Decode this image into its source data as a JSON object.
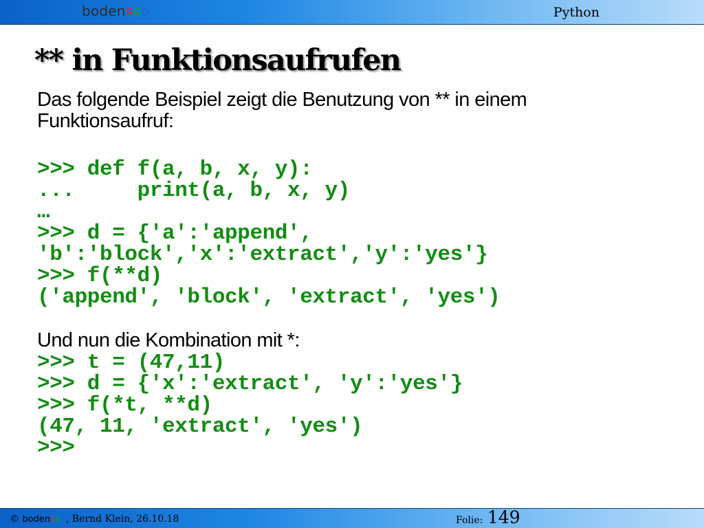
{
  "header": {
    "logo": {
      "part1": "boden",
      "part_s": "s",
      "part_e": "e",
      "part_o": "o"
    },
    "title": "Python"
  },
  "slide": {
    "title": "** in Funktionsaufrufen",
    "intro": "Das folgende Beispiel zeigt die Benutzung von ** in einem Funktionsaufruf:",
    "code_block_1": [
      ">>> def f(a, b, x, y):",
      "...     print(a, b, x, y)",
      "…",
      ">>> d = {'a':'append',",
      "'b':'block','x':'extract','y':'yes'}",
      ">>> f(**d)",
      "('append', 'block', 'extract', 'yes')"
    ],
    "combo_intro": "Und nun die Kombination mit *:",
    "code_block_2": [
      ">>> t = (47,11)",
      ">>> d = {'x':'extract', 'y':'yes'}",
      ">>> f(*t, **d)",
      "(47, 11, 'extract', 'yes')",
      ">>>"
    ]
  },
  "footer": {
    "copyright_symbol": "©",
    "brand_part1": "boden",
    "brand_s": "s",
    "brand_e": "e",
    "brand_o": "o",
    "author_date": ", Bernd Klein, 26.10.18",
    "folie_label": "Folie:",
    "folie_number": "149"
  },
  "colors": {
    "code_green": "#138c13",
    "bar_blue": "#1d86e3",
    "logo_red": "#e0281f",
    "logo_green": "#1e9a2a",
    "logo_blue": "#1a66d6"
  }
}
